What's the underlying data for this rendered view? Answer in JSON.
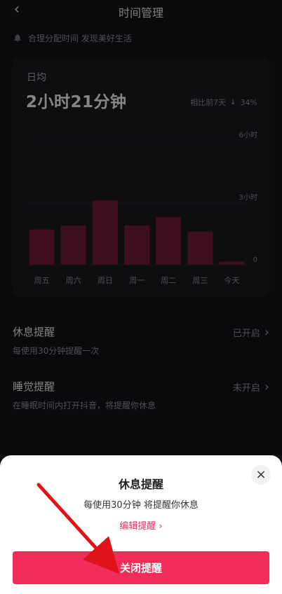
{
  "app": {
    "title": "时间管理"
  },
  "header": {
    "back_icon": "chevron-left-icon"
  },
  "tip": {
    "icon": "bell-icon",
    "text": "合理分配时间 发现美好生活"
  },
  "summary": {
    "avg_label": "日均",
    "avg_value": "2小时21分钟",
    "compare_label": "相比前7天",
    "compare_change": "34%",
    "compare_direction": "down"
  },
  "chart_data": {
    "type": "bar",
    "categories": [
      "周五",
      "周六",
      "周日",
      "周一",
      "周二",
      "周三",
      "今天"
    ],
    "values": [
      1.7,
      1.9,
      3.1,
      1.9,
      2.3,
      1.6,
      0.15
    ],
    "y_ticks": [
      {
        "label": "6小时",
        "value": 6
      },
      {
        "label": "3小时",
        "value": 3
      },
      {
        "label": "0",
        "value": 0
      }
    ],
    "ylim": [
      0,
      6
    ],
    "colors": {
      "bar": "#6f1c35",
      "bar_highlight": "#b4264f",
      "grid": "#2b2b31"
    }
  },
  "settings": [
    {
      "title": "休息提醒",
      "desc": "每使用30分钟提醒一次",
      "state": "已开启"
    },
    {
      "title": "睡觉提醒",
      "desc": "在睡眠时间内打开抖音，将提醒你休息",
      "state": "未开启"
    }
  ],
  "sheet": {
    "title": "休息提醒",
    "desc": "每使用30分钟 将提醒你休息",
    "edit_link": "编辑提醒",
    "close_icon": "close-icon",
    "primary_button": "关闭提醒"
  },
  "colors": {
    "accent": "#f02c58",
    "link": "#d63c62",
    "annotation_arrow": "#e0131b"
  }
}
